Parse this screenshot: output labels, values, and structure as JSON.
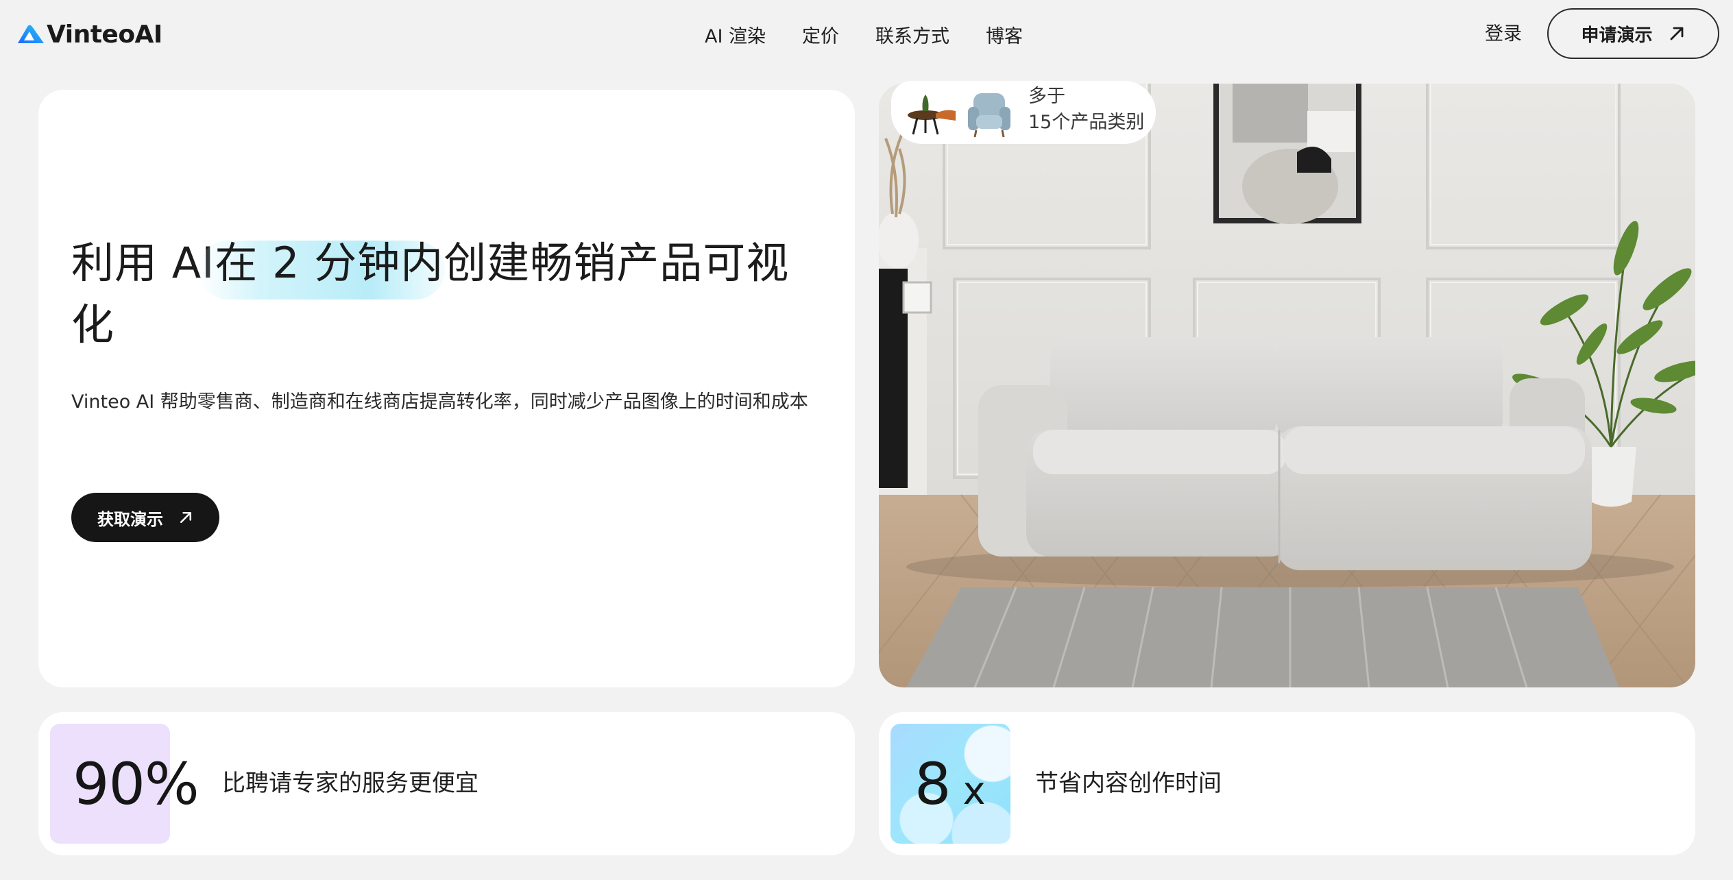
{
  "header": {
    "logo_text": "VinteoAI",
    "nav": [
      "AI 渲染",
      "定价",
      "联系方式",
      "博客"
    ],
    "login_label": "登录",
    "demo_label": "申请演示"
  },
  "hero": {
    "title_before": "利用 AI",
    "title_highlight": "在 2 分钟内",
    "title_after": "创建畅销产品可视化",
    "subtitle": "Vinteo AI 帮助零售商、制造商和在线商店提高转化率，同时减少产品图像上的时间和成本",
    "cta_label": "获取演示"
  },
  "category_badge": {
    "line1": "多于",
    "line2": "15个产品类别"
  },
  "stats": [
    {
      "value": "90%",
      "label": "比聘请专家的服务更便宜"
    },
    {
      "value": "8",
      "suffix": "x",
      "label": "节省内容创作时间"
    }
  ],
  "colors": {
    "background": "#f2f2f2",
    "card": "#ffffff",
    "cta": "#161616",
    "logo_gradient": [
      "#1f6bff",
      "#27c6f2"
    ],
    "highlight": "#b8ecf8",
    "stat_tile_purple": "#ece0fd",
    "stat_tile_blue": "#9de6fb"
  },
  "icons": {
    "logo": "vinteo-logo-mark",
    "demo": "arrow-up-right-icon",
    "cta": "arrow-up-right-icon"
  }
}
